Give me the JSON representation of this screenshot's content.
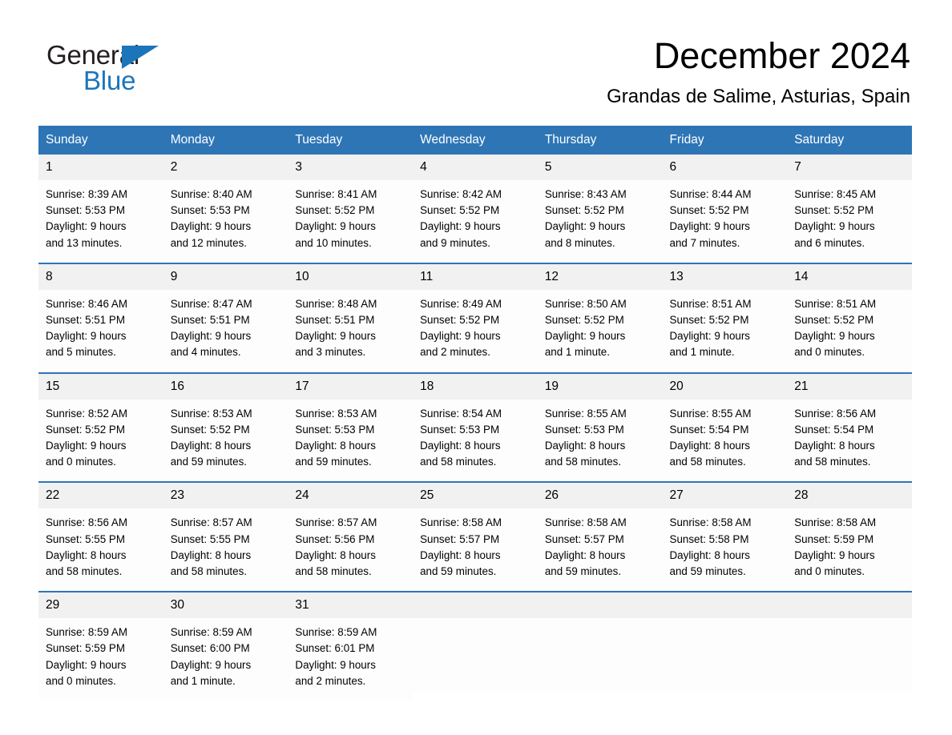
{
  "brand": {
    "name_part1": "General",
    "name_part2": "Blue",
    "accent_color": "#1b75bb"
  },
  "header": {
    "title": "December 2024",
    "subtitle": "Grandas de Salime, Asturias, Spain"
  },
  "theme": {
    "header_blue": "#2e75b6",
    "daynum_background": "#f1f1f1",
    "cell_background": "#fdfdfd"
  },
  "weekday_headers": [
    "Sunday",
    "Monday",
    "Tuesday",
    "Wednesday",
    "Thursday",
    "Friday",
    "Saturday"
  ],
  "weeks": [
    [
      {
        "day": "1",
        "sunrise": "Sunrise: 8:39 AM",
        "sunset": "Sunset: 5:53 PM",
        "daylight1": "Daylight: 9 hours",
        "daylight2": "and 13 minutes."
      },
      {
        "day": "2",
        "sunrise": "Sunrise: 8:40 AM",
        "sunset": "Sunset: 5:53 PM",
        "daylight1": "Daylight: 9 hours",
        "daylight2": "and 12 minutes."
      },
      {
        "day": "3",
        "sunrise": "Sunrise: 8:41 AM",
        "sunset": "Sunset: 5:52 PM",
        "daylight1": "Daylight: 9 hours",
        "daylight2": "and 10 minutes."
      },
      {
        "day": "4",
        "sunrise": "Sunrise: 8:42 AM",
        "sunset": "Sunset: 5:52 PM",
        "daylight1": "Daylight: 9 hours",
        "daylight2": "and 9 minutes."
      },
      {
        "day": "5",
        "sunrise": "Sunrise: 8:43 AM",
        "sunset": "Sunset: 5:52 PM",
        "daylight1": "Daylight: 9 hours",
        "daylight2": "and 8 minutes."
      },
      {
        "day": "6",
        "sunrise": "Sunrise: 8:44 AM",
        "sunset": "Sunset: 5:52 PM",
        "daylight1": "Daylight: 9 hours",
        "daylight2": "and 7 minutes."
      },
      {
        "day": "7",
        "sunrise": "Sunrise: 8:45 AM",
        "sunset": "Sunset: 5:52 PM",
        "daylight1": "Daylight: 9 hours",
        "daylight2": "and 6 minutes."
      }
    ],
    [
      {
        "day": "8",
        "sunrise": "Sunrise: 8:46 AM",
        "sunset": "Sunset: 5:51 PM",
        "daylight1": "Daylight: 9 hours",
        "daylight2": "and 5 minutes."
      },
      {
        "day": "9",
        "sunrise": "Sunrise: 8:47 AM",
        "sunset": "Sunset: 5:51 PM",
        "daylight1": "Daylight: 9 hours",
        "daylight2": "and 4 minutes."
      },
      {
        "day": "10",
        "sunrise": "Sunrise: 8:48 AM",
        "sunset": "Sunset: 5:51 PM",
        "daylight1": "Daylight: 9 hours",
        "daylight2": "and 3 minutes."
      },
      {
        "day": "11",
        "sunrise": "Sunrise: 8:49 AM",
        "sunset": "Sunset: 5:52 PM",
        "daylight1": "Daylight: 9 hours",
        "daylight2": "and 2 minutes."
      },
      {
        "day": "12",
        "sunrise": "Sunrise: 8:50 AM",
        "sunset": "Sunset: 5:52 PM",
        "daylight1": "Daylight: 9 hours",
        "daylight2": "and 1 minute."
      },
      {
        "day": "13",
        "sunrise": "Sunrise: 8:51 AM",
        "sunset": "Sunset: 5:52 PM",
        "daylight1": "Daylight: 9 hours",
        "daylight2": "and 1 minute."
      },
      {
        "day": "14",
        "sunrise": "Sunrise: 8:51 AM",
        "sunset": "Sunset: 5:52 PM",
        "daylight1": "Daylight: 9 hours",
        "daylight2": "and 0 minutes."
      }
    ],
    [
      {
        "day": "15",
        "sunrise": "Sunrise: 8:52 AM",
        "sunset": "Sunset: 5:52 PM",
        "daylight1": "Daylight: 9 hours",
        "daylight2": "and 0 minutes."
      },
      {
        "day": "16",
        "sunrise": "Sunrise: 8:53 AM",
        "sunset": "Sunset: 5:52 PM",
        "daylight1": "Daylight: 8 hours",
        "daylight2": "and 59 minutes."
      },
      {
        "day": "17",
        "sunrise": "Sunrise: 8:53 AM",
        "sunset": "Sunset: 5:53 PM",
        "daylight1": "Daylight: 8 hours",
        "daylight2": "and 59 minutes."
      },
      {
        "day": "18",
        "sunrise": "Sunrise: 8:54 AM",
        "sunset": "Sunset: 5:53 PM",
        "daylight1": "Daylight: 8 hours",
        "daylight2": "and 58 minutes."
      },
      {
        "day": "19",
        "sunrise": "Sunrise: 8:55 AM",
        "sunset": "Sunset: 5:53 PM",
        "daylight1": "Daylight: 8 hours",
        "daylight2": "and 58 minutes."
      },
      {
        "day": "20",
        "sunrise": "Sunrise: 8:55 AM",
        "sunset": "Sunset: 5:54 PM",
        "daylight1": "Daylight: 8 hours",
        "daylight2": "and 58 minutes."
      },
      {
        "day": "21",
        "sunrise": "Sunrise: 8:56 AM",
        "sunset": "Sunset: 5:54 PM",
        "daylight1": "Daylight: 8 hours",
        "daylight2": "and 58 minutes."
      }
    ],
    [
      {
        "day": "22",
        "sunrise": "Sunrise: 8:56 AM",
        "sunset": "Sunset: 5:55 PM",
        "daylight1": "Daylight: 8 hours",
        "daylight2": "and 58 minutes."
      },
      {
        "day": "23",
        "sunrise": "Sunrise: 8:57 AM",
        "sunset": "Sunset: 5:55 PM",
        "daylight1": "Daylight: 8 hours",
        "daylight2": "and 58 minutes."
      },
      {
        "day": "24",
        "sunrise": "Sunrise: 8:57 AM",
        "sunset": "Sunset: 5:56 PM",
        "daylight1": "Daylight: 8 hours",
        "daylight2": "and 58 minutes."
      },
      {
        "day": "25",
        "sunrise": "Sunrise: 8:58 AM",
        "sunset": "Sunset: 5:57 PM",
        "daylight1": "Daylight: 8 hours",
        "daylight2": "and 59 minutes."
      },
      {
        "day": "26",
        "sunrise": "Sunrise: 8:58 AM",
        "sunset": "Sunset: 5:57 PM",
        "daylight1": "Daylight: 8 hours",
        "daylight2": "and 59 minutes."
      },
      {
        "day": "27",
        "sunrise": "Sunrise: 8:58 AM",
        "sunset": "Sunset: 5:58 PM",
        "daylight1": "Daylight: 8 hours",
        "daylight2": "and 59 minutes."
      },
      {
        "day": "28",
        "sunrise": "Sunrise: 8:58 AM",
        "sunset": "Sunset: 5:59 PM",
        "daylight1": "Daylight: 9 hours",
        "daylight2": "and 0 minutes."
      }
    ],
    [
      {
        "day": "29",
        "sunrise": "Sunrise: 8:59 AM",
        "sunset": "Sunset: 5:59 PM",
        "daylight1": "Daylight: 9 hours",
        "daylight2": "and 0 minutes."
      },
      {
        "day": "30",
        "sunrise": "Sunrise: 8:59 AM",
        "sunset": "Sunset: 6:00 PM",
        "daylight1": "Daylight: 9 hours",
        "daylight2": "and 1 minute."
      },
      {
        "day": "31",
        "sunrise": "Sunrise: 8:59 AM",
        "sunset": "Sunset: 6:01 PM",
        "daylight1": "Daylight: 9 hours",
        "daylight2": "and 2 minutes."
      },
      {
        "day": "",
        "sunrise": "",
        "sunset": "",
        "daylight1": "",
        "daylight2": ""
      },
      {
        "day": "",
        "sunrise": "",
        "sunset": "",
        "daylight1": "",
        "daylight2": ""
      },
      {
        "day": "",
        "sunrise": "",
        "sunset": "",
        "daylight1": "",
        "daylight2": ""
      },
      {
        "day": "",
        "sunrise": "",
        "sunset": "",
        "daylight1": "",
        "daylight2": ""
      }
    ]
  ]
}
